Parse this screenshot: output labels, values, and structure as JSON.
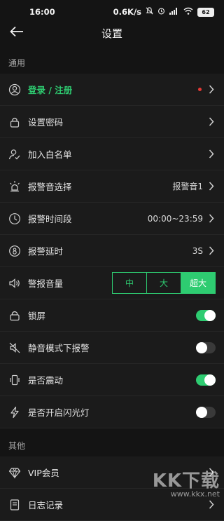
{
  "status_bar": {
    "time": "16:00",
    "network_speed": "0.6K/s",
    "battery": "62"
  },
  "nav": {
    "title": "设置"
  },
  "sections": [
    {
      "header": "通用"
    },
    {
      "header": "其他"
    }
  ],
  "rows": {
    "login": {
      "label": "登录 / 注册"
    },
    "password": {
      "label": "设置密码"
    },
    "whitelist": {
      "label": "加入白名单"
    },
    "alarm_sound": {
      "label": "报警音选择",
      "value": "报警音1"
    },
    "alarm_period": {
      "label": "报警时间段",
      "value": "00:00~23:59"
    },
    "alarm_delay": {
      "label": "报警延时",
      "value": "3S"
    },
    "alarm_volume": {
      "label": "警报音量",
      "options": [
        "中",
        "大",
        "超大"
      ],
      "selected": "超大"
    },
    "lock_screen": {
      "label": "锁屏",
      "on": true
    },
    "silent_alarm": {
      "label": "静音模式下报警",
      "on": false
    },
    "vibrate": {
      "label": "是否震动",
      "on": true
    },
    "flashlight": {
      "label": "是否开启闪光灯",
      "on": false
    },
    "vip": {
      "label": "VIP会员"
    },
    "log": {
      "label": "日志记录"
    }
  },
  "watermark": {
    "text": "KK下载",
    "url": "www.kkx.net"
  },
  "colors": {
    "accent": "#2ecc71",
    "background": "#141414",
    "row_bg": "#1b1b1b",
    "dot": "#e53935"
  }
}
